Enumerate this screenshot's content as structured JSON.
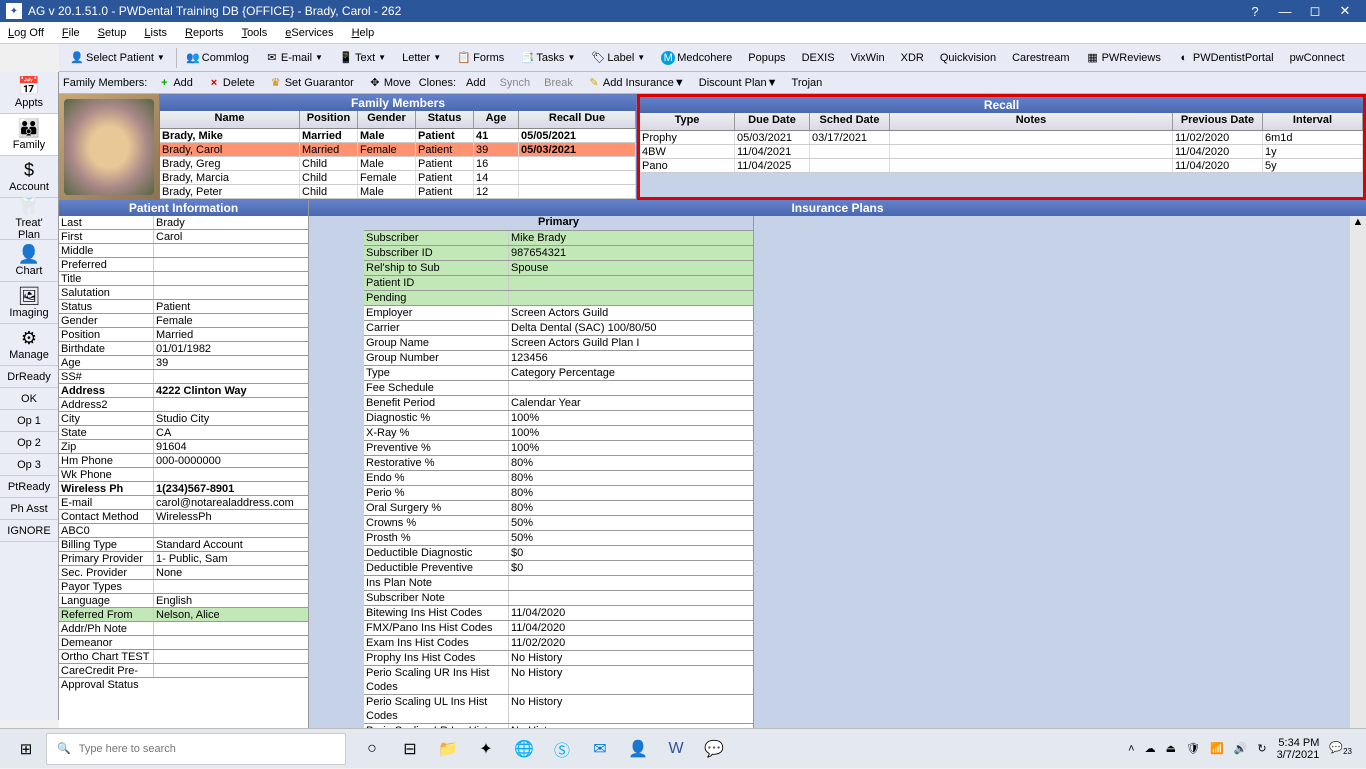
{
  "titlebar": {
    "text": "AG v 20.1.51.0 - PWDental Training DB {OFFICE} - Brady, Carol - 262"
  },
  "menubar": [
    "Log Off",
    "File",
    "Setup",
    "Lists",
    "Reports",
    "Tools",
    "eServices",
    "Help"
  ],
  "toolbar1": {
    "select_patient": "Select Patient",
    "commlog": "Commlog",
    "email": "E-mail",
    "text": "Text",
    "letter": "Letter",
    "forms": "Forms",
    "tasks": "Tasks",
    "label": "Label",
    "medcohere": "Medcohere",
    "popups": "Popups",
    "dexis": "DEXIS",
    "vixwin": "VixWin",
    "xdr": "XDR",
    "quickvision": "Quickvision",
    "carestream": "Carestream",
    "pwreviews": "PWReviews",
    "pwdentistportal": "PWDentistPortal",
    "pwconnect": "pwConnect"
  },
  "toolbar2": {
    "family_members": "Family Members:",
    "add": "Add",
    "delete": "Delete",
    "set_guarantor": "Set Guarantor",
    "move": "Move",
    "clones": "Clones:",
    "clones_add": "Add",
    "clones_synch": "Synch",
    "clones_break": "Break",
    "add_insurance": "Add Insurance",
    "discount_plan": "Discount Plan",
    "trojan": "Trojan"
  },
  "sidebar": {
    "appts": "Appts",
    "family": "Family",
    "account": "Account",
    "treat_plan": "Treat'\nPlan",
    "chart": "Chart",
    "imaging": "Imaging",
    "manage": "Manage",
    "drready": "DrReady",
    "ok": "OK",
    "op1": "Op 1",
    "op2": "Op 2",
    "op3": "Op 3",
    "ptready": "PtReady",
    "ph_asst": "Ph Asst",
    "ignore": "IGNORE"
  },
  "family_panel": {
    "title": "Family Members",
    "cols": [
      "Name",
      "Position",
      "Gender",
      "Status",
      "Age",
      "Recall Due"
    ],
    "rows": [
      {
        "name": "Brady, Mike",
        "pos": "Married",
        "gen": "Male",
        "stat": "Patient",
        "age": "41",
        "recall": "05/05/2021",
        "bold": true
      },
      {
        "name": "Brady, Carol",
        "pos": "Married",
        "gen": "Female",
        "stat": "Patient",
        "age": "39",
        "recall": "05/03/2021",
        "sel": true
      },
      {
        "name": "Brady, Greg",
        "pos": "Child",
        "gen": "Male",
        "stat": "Patient",
        "age": "16",
        "recall": ""
      },
      {
        "name": "Brady, Marcia",
        "pos": "Child",
        "gen": "Female",
        "stat": "Patient",
        "age": "14",
        "recall": ""
      },
      {
        "name": "Brady, Peter",
        "pos": "Child",
        "gen": "Male",
        "stat": "Patient",
        "age": "12",
        "recall": ""
      }
    ]
  },
  "recall_panel": {
    "title": "Recall",
    "cols": [
      "Type",
      "Due Date",
      "Sched Date",
      "Notes",
      "Previous Date",
      "Interval"
    ],
    "rows": [
      {
        "type": "Prophy",
        "due": "05/03/2021",
        "sched": "03/17/2021",
        "notes": "",
        "prev": "11/02/2020",
        "int": "6m1d"
      },
      {
        "type": "4BW",
        "due": "11/04/2021",
        "sched": "",
        "notes": "",
        "prev": "11/04/2020",
        "int": "1y"
      },
      {
        "type": "Pano",
        "due": "11/04/2025",
        "sched": "",
        "notes": "",
        "prev": "11/04/2020",
        "int": "5y"
      }
    ]
  },
  "pinfo": {
    "title": "Patient Information",
    "rows": [
      {
        "k": "Last",
        "v": "Brady"
      },
      {
        "k": "First",
        "v": "Carol"
      },
      {
        "k": "Middle",
        "v": ""
      },
      {
        "k": "Preferred",
        "v": ""
      },
      {
        "k": "Title",
        "v": ""
      },
      {
        "k": "Salutation",
        "v": ""
      },
      {
        "k": "Status",
        "v": "Patient"
      },
      {
        "k": "Gender",
        "v": "Female"
      },
      {
        "k": "Position",
        "v": "Married"
      },
      {
        "k": "Birthdate",
        "v": "01/01/1982"
      },
      {
        "k": "Age",
        "v": "39"
      },
      {
        "k": "SS#",
        "v": ""
      },
      {
        "k": "Address",
        "v": "4222 Clinton Way",
        "bold": true
      },
      {
        "k": "Address2",
        "v": ""
      },
      {
        "k": "City",
        "v": "Studio City"
      },
      {
        "k": "State",
        "v": "CA"
      },
      {
        "k": "Zip",
        "v": "91604"
      },
      {
        "k": "Hm Phone",
        "v": "000-0000000"
      },
      {
        "k": "Wk Phone",
        "v": ""
      },
      {
        "k": "Wireless Ph",
        "v": "1(234)567-8901",
        "bold": true
      },
      {
        "k": "E-mail",
        "v": "carol@notarealaddress.com"
      },
      {
        "k": "Contact Method",
        "v": "WirelessPh"
      },
      {
        "k": "ABC0",
        "v": ""
      },
      {
        "k": "Billing Type",
        "v": "Standard Account"
      },
      {
        "k": "Primary Provider",
        "v": "1- Public, Sam"
      },
      {
        "k": "Sec. Provider",
        "v": "None"
      },
      {
        "k": "Payor Types",
        "v": ""
      },
      {
        "k": "Language",
        "v": "English"
      },
      {
        "k": "Referred From",
        "v": "Nelson, Alice",
        "hl": true
      },
      {
        "k": "Addr/Ph Note",
        "v": ""
      },
      {
        "k": "Demeanor",
        "v": ""
      },
      {
        "k": "Ortho Chart TEST",
        "v": ""
      },
      {
        "k": "CareCredit Pre-Approval Status",
        "v": ""
      }
    ]
  },
  "ins": {
    "title": "Insurance Plans",
    "col_title": "Primary",
    "rows": [
      {
        "k": "Subscriber",
        "v": "Mike Brady",
        "hl": true
      },
      {
        "k": "Subscriber ID",
        "v": "987654321",
        "hl": true
      },
      {
        "k": "Rel'ship to Sub",
        "v": "Spouse",
        "hl": true
      },
      {
        "k": "Patient ID",
        "v": "",
        "hl": true
      },
      {
        "k": "Pending",
        "v": "",
        "hl": true
      },
      {
        "k": "Employer",
        "v": "Screen Actors Guild"
      },
      {
        "k": "Carrier",
        "v": "Delta Dental (SAC) 100/80/50"
      },
      {
        "k": "Group Name",
        "v": "Screen Actors Guild Plan I"
      },
      {
        "k": "Group Number",
        "v": "123456"
      },
      {
        "k": "Type",
        "v": "Category Percentage"
      },
      {
        "k": "Fee Schedule",
        "v": ""
      },
      {
        "k": "Benefit Period",
        "v": "Calendar Year"
      },
      {
        "k": "Diagnostic %",
        "v": "100%"
      },
      {
        "k": "X-Ray %",
        "v": "100%"
      },
      {
        "k": "Preventive %",
        "v": "100%"
      },
      {
        "k": "Restorative %",
        "v": "80%"
      },
      {
        "k": "Endo %",
        "v": "80%"
      },
      {
        "k": "Perio %",
        "v": "80%"
      },
      {
        "k": "Oral Surgery %",
        "v": "80%"
      },
      {
        "k": "Crowns %",
        "v": "50%"
      },
      {
        "k": "Prosth %",
        "v": "50%"
      },
      {
        "k": "Deductible Diagnostic",
        "v": "$0"
      },
      {
        "k": "Deductible Preventive",
        "v": "$0"
      },
      {
        "k": "Ins Plan Note",
        "v": ""
      },
      {
        "k": "Subscriber Note",
        "v": ""
      },
      {
        "k": "Bitewing Ins Hist Codes",
        "v": "11/04/2020"
      },
      {
        "k": "FMX/Pano Ins Hist Codes",
        "v": "11/04/2020"
      },
      {
        "k": "Exam Ins Hist Codes",
        "v": "11/02/2020"
      },
      {
        "k": "Prophy Ins Hist Codes",
        "v": "No History"
      },
      {
        "k": "Perio Scaling UR Ins Hist Codes",
        "v": "No History"
      },
      {
        "k": "Perio Scaling UL Ins Hist Codes",
        "v": "No History"
      },
      {
        "k": "Perio Scaling LR Ins Hist Codes",
        "v": "No History"
      }
    ]
  },
  "taskbar": {
    "search_placeholder": "Type here to search",
    "time": "5:34 PM",
    "date": "3/7/2021",
    "notif": "23"
  }
}
